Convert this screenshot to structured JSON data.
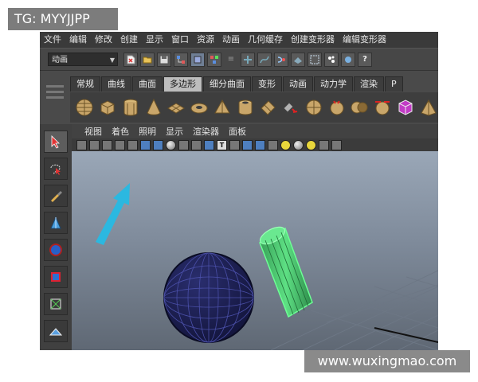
{
  "watermark_top": "TG: MYYJJPP",
  "watermark_bottom": "www.wuxingmao.com",
  "menubar": [
    "文件",
    "编辑",
    "修改",
    "创建",
    "显示",
    "窗口",
    "资源",
    "动画",
    "几何缓存",
    "创建变形器",
    "编辑变形器"
  ],
  "status_line": {
    "mode_label": "动画"
  },
  "shelf_tabs": [
    "常规",
    "曲线",
    "曲面",
    "多边形",
    "细分曲面",
    "变形",
    "动画",
    "动力学",
    "渲染",
    "P"
  ],
  "active_shelf_tab": "多边形",
  "shelf_icons": [
    "poly-sphere-icon",
    "poly-cube-icon",
    "poly-cylinder-icon",
    "poly-cone-icon",
    "poly-plane-icon",
    "poly-torus-icon",
    "poly-prism-icon",
    "poly-pipe-icon",
    "poly-helix-icon",
    "combine-icon",
    "separate-icon",
    "smooth-icon",
    "boolean-icon",
    "mirror-icon",
    "purple-cube-icon",
    "pyramid-icon"
  ],
  "panel_menu": [
    "视图",
    "着色",
    "照明",
    "显示",
    "渲染器",
    "面板"
  ],
  "colors": {
    "arrow": "#2bb8e0",
    "sphere": "#1c1f52",
    "cylinder": "#4dd870",
    "shelf_active": "#bdbdbd"
  }
}
